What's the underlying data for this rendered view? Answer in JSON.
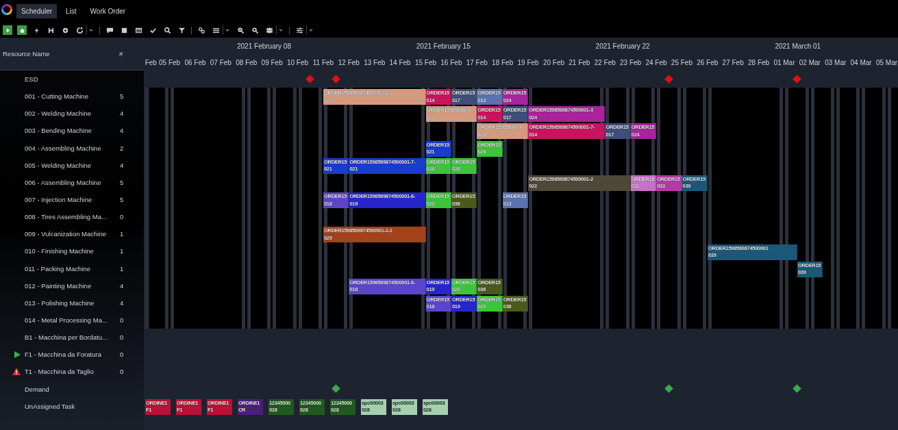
{
  "tabs": [
    {
      "label": "Scheduler",
      "selected": true
    },
    {
      "label": "List",
      "selected": false
    },
    {
      "label": "Work Order",
      "selected": false
    }
  ],
  "resource_panel": {
    "columns": [
      "Resource Name",
      "#"
    ]
  },
  "timeline": {
    "weeks": [
      "2021 February 08",
      "2021 February 15",
      "2021 February 22",
      "2021 March 01"
    ],
    "days": [
      "Feb",
      "05 Feb",
      "06 Feb",
      "07 Feb",
      "08 Feb",
      "09 Feb",
      "10 Feb",
      "11 Feb",
      "12 Feb",
      "13 Feb",
      "14 Feb",
      "15 Feb",
      "16 Feb",
      "17 Feb",
      "18 Feb",
      "19 Feb",
      "20 Feb",
      "21 Feb",
      "22 Feb",
      "23 Feb",
      "24 Feb",
      "25 Feb",
      "26 Feb",
      "27 Feb",
      "28 Feb",
      "01 Mar",
      "02 Mar",
      "03 Mar",
      "04 Mar",
      "05 Mar"
    ]
  },
  "rows": [
    {
      "kind": "esd",
      "name": "ESD"
    },
    {
      "kind": "resource",
      "name": "001 - Cutting Machine",
      "count": "5",
      "tasks": [
        {
          "order": "ORDER1598569874500001-2-1",
          "code": "023",
          "color": "#d49a80"
        },
        {
          "order": "ORDER15",
          "code": "014",
          "color": "#c8145e"
        },
        {
          "order": "ORDER15",
          "code": "017",
          "color": "#3d4e7a"
        },
        {
          "order": "ORDER15",
          "code": "013",
          "color": "#5a72b0"
        },
        {
          "order": "ORDER15",
          "code": "024",
          "color": "#a8239c"
        }
      ]
    },
    {
      "kind": "resource",
      "name": "002 - Welding Machine",
      "count": "4",
      "tasks": [
        {
          "order": "ORDER1598569874",
          "code": "023",
          "color": "#d49a80"
        },
        {
          "order": "ORDER15",
          "code": "014",
          "color": "#c8145e"
        },
        {
          "order": "ORDER15",
          "code": "017",
          "color": "#3d4e7a"
        },
        {
          "order": "ORDER1598569874500001-3",
          "code": "024",
          "color": "#a8239c"
        }
      ]
    },
    {
      "kind": "resource",
      "name": "003 - Bending Machine",
      "count": "4",
      "tasks": [
        {
          "order": "ORDER1598569874",
          "code": "023",
          "color": "#d49a80"
        },
        {
          "order": "ORDER1598569874500001-7-",
          "code": "014",
          "color": "#c8145e"
        },
        {
          "order": "ORDER15",
          "code": "017",
          "color": "#3d4e7a"
        },
        {
          "order": "ORDER15",
          "code": "024",
          "color": "#a8239c"
        }
      ]
    },
    {
      "kind": "resource",
      "name": "004 - Assembling Machine",
      "count": "2",
      "tasks": [
        {
          "order": "ORDER15",
          "code": "021",
          "color": "#1a3ccc"
        },
        {
          "order": "ORDER15",
          "code": "028",
          "color": "#3cc43c"
        }
      ]
    },
    {
      "kind": "resource",
      "name": "005 - Welding Machine",
      "count": "4",
      "tasks": [
        {
          "order": "ORDER15",
          "code": "021",
          "color": "#1a3ccc"
        },
        {
          "order": "ORDER1598569874500001-7-",
          "code": "021",
          "color": "#1a3ccc"
        },
        {
          "order": "ORDER15",
          "code": "028",
          "color": "#3cc43c"
        },
        {
          "order": "ORDER15",
          "code": "028",
          "color": "#3cc43c"
        }
      ]
    },
    {
      "kind": "resource",
      "name": "006 - Assembling Machine",
      "count": "5",
      "tasks": [
        {
          "order": "ORDER1598569874500001-2",
          "code": "022",
          "color": "#4e4838"
        },
        {
          "order": "ORDER15",
          "code": "031",
          "color": "#c670c6"
        },
        {
          "order": "ORDER15",
          "code": "033",
          "color": "#b23aa6"
        },
        {
          "order": "ORDER15",
          "code": "039",
          "color": "#1b5878"
        }
      ]
    },
    {
      "kind": "resource",
      "name": "007 - Injection Machine",
      "count": "5",
      "tasks": [
        {
          "order": "ORDER15",
          "code": "018",
          "color": "#5b45c8"
        },
        {
          "order": "ORDER1598569874500001-6-",
          "code": "019",
          "color": "#2626cc"
        },
        {
          "order": "ORDER15",
          "code": "020",
          "color": "#3cc43c"
        },
        {
          "order": "ORDER15",
          "code": "036",
          "color": "#4b5a1c"
        },
        {
          "order": "ORDER15",
          "code": "013",
          "color": "#5a72b0"
        }
      ]
    },
    {
      "kind": "resource",
      "name": "008 - Tires Assembling Ma...",
      "count": "0"
    },
    {
      "kind": "resource",
      "name": "009 - Vulcanization Machine",
      "count": "1",
      "tasks": [
        {
          "order": "ORDER1598569874500001-2-2",
          "code": "029",
          "color": "#a4421c"
        }
      ]
    },
    {
      "kind": "resource",
      "name": "010 - Finishing Machine",
      "count": "1",
      "tasks": [
        {
          "order": "ORDER1598569874500001",
          "code": "039",
          "color": "#1b5878"
        }
      ]
    },
    {
      "kind": "resource",
      "name": "011 - Packing Machine",
      "count": "1",
      "tasks": [
        {
          "order": "ORDER15",
          "code": "039",
          "color": "#1b5878"
        }
      ]
    },
    {
      "kind": "resource",
      "name": "012 - Painting Machine",
      "count": "4",
      "tasks": [
        {
          "order": "ORDER1598569874500001-6-",
          "code": "018",
          "color": "#5b45c8"
        },
        {
          "order": "ORDER15",
          "code": "019",
          "color": "#2626cc"
        },
        {
          "order": "ORDER15",
          "code": "020",
          "color": "#3cc43c"
        },
        {
          "order": "ORDER15",
          "code": "036",
          "color": "#4b5a1c"
        }
      ]
    },
    {
      "kind": "resource",
      "name": "013 - Polishing Machine",
      "count": "4",
      "tasks": [
        {
          "order": "ORDER15",
          "code": "018",
          "color": "#5b45c8"
        },
        {
          "order": "ORDER15",
          "code": "019",
          "color": "#2626cc"
        },
        {
          "order": "ORDER15",
          "code": "020",
          "color": "#3cc43c"
        },
        {
          "order": "ORDER15",
          "code": "036",
          "color": "#4b5a1c"
        }
      ]
    },
    {
      "kind": "resource",
      "name": "014 - Metal Processing Ma...",
      "count": "0"
    },
    {
      "kind": "resource",
      "name": "B1 - Macchina per Bordatu...",
      "count": "0"
    },
    {
      "kind": "running",
      "name": "F1 - Macchina da Foratura",
      "count": "0"
    },
    {
      "kind": "warning",
      "name": "T1 - Macchina da Taglio",
      "count": "0"
    },
    {
      "kind": "demand",
      "name": "Demand"
    },
    {
      "kind": "unassigned",
      "name": "UnAssigned Task",
      "tasks": [
        {
          "order": "ORDINE1",
          "code": "F1",
          "color": "#b81236"
        },
        {
          "order": "ORDINE1",
          "code": "F1",
          "color": "#b81236"
        },
        {
          "order": "ORDINE1",
          "code": "F1",
          "color": "#b81236"
        },
        {
          "order": "ORDINE1",
          "code": "CR",
          "color": "#4a1f7a"
        },
        {
          "order": "12345000",
          "code": "028",
          "color": "#1e5a1e"
        },
        {
          "order": "12345000",
          "code": "028",
          "color": "#1e5a1e"
        },
        {
          "order": "12345000",
          "code": "028",
          "color": "#1e5a1e"
        },
        {
          "order": "spc00003",
          "code": "028",
          "color": "#a6cfb0"
        },
        {
          "order": "spc00003",
          "code": "028",
          "color": "#a6cfb0"
        },
        {
          "order": "spc00003",
          "code": "028",
          "color": "#a6cfb0"
        }
      ]
    }
  ]
}
